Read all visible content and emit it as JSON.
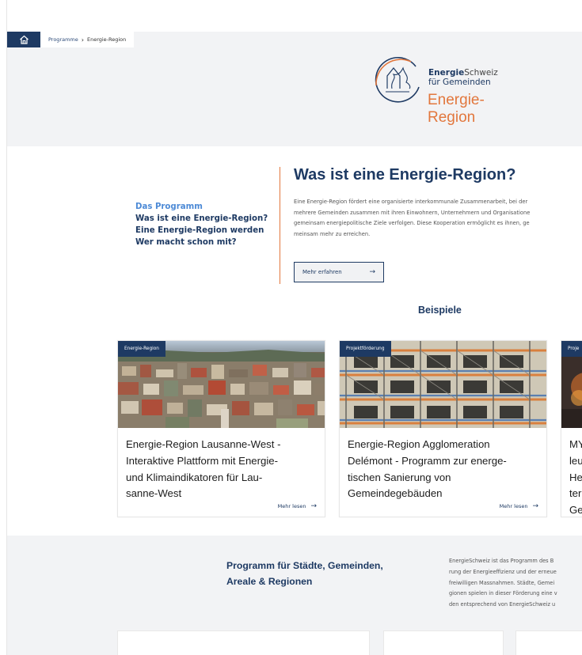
{
  "breadcrumb": {
    "home_icon": "home-icon",
    "parent": "Programme",
    "separator": "›",
    "current": "Energie-Region"
  },
  "logo": {
    "brand_bold": "Energie",
    "brand_rest": "Schweiz",
    "brand_line2": "für Gemeinden",
    "program_line1": "Energie-",
    "program_line2": "Region"
  },
  "sidenav": {
    "items": [
      {
        "label": "Das Programm",
        "active": true
      },
      {
        "label": "Was ist eine Energie-Region?",
        "active": false
      },
      {
        "label": "Eine Energie-Region werden",
        "active": false
      },
      {
        "label": "Wer macht schon mit?",
        "active": false
      }
    ]
  },
  "intro": {
    "title": "Was ist eine Energie-Region?",
    "text_lines": [
      "Eine Energie-Region fördert eine organisierte interkommunale Zusammenarbeit, bei der",
      "mehrere Gemeinden zusammen mit ihren Einwohnern, Unternehmern und Organisatione",
      "gemeinsam energiepolitische Ziele verfolgen. Diese Kooperation ermöglicht es ihnen, ge",
      "meinsam mehr zu erreichen."
    ],
    "button_label": "Mehr erfahren",
    "button_arrow": "→"
  },
  "examples": {
    "title": "Beispiele",
    "cards": [
      {
        "tag": "Energie-Region",
        "title_lines": [
          "Energie-Region Lausanne-West -",
          "Interaktive Plattform mit Energie-",
          "und Klimaindikatoren für Lau-",
          "sanne-West"
        ],
        "more": "Mehr lesen",
        "arrow": "→"
      },
      {
        "tag": "Projektförderung",
        "title_lines": [
          "Energie-Region Agglomeration",
          "Delémont - Programm zur energe-",
          "tischen Sanierung von",
          "Gemeindegebäuden"
        ],
        "more": "Mehr lesen",
        "arrow": "→"
      },
      {
        "tag": "Proje",
        "title_lines": [
          "MY",
          "leu",
          "He",
          "ter",
          "Ge"
        ],
        "more": "",
        "arrow": ""
      }
    ]
  },
  "program": {
    "title_lines": [
      "Programm für Städte, Gemeinden,",
      "Areale & Regionen"
    ],
    "text_lines": [
      "EnergieSchweiz ist das Programm des B",
      "rung der Energieeffizienz und der erneue",
      "freiwilligen Massnahmen. Städte, Gemei",
      "gionen spielen in dieser Förderung eine v",
      "den entsprechend von EnergieSchweiz u"
    ]
  },
  "colors": {
    "navy": "#1e3a63",
    "accent_orange": "#e2773d",
    "link_blue": "#4d8ad6",
    "band_gray": "#f2f3f5"
  }
}
